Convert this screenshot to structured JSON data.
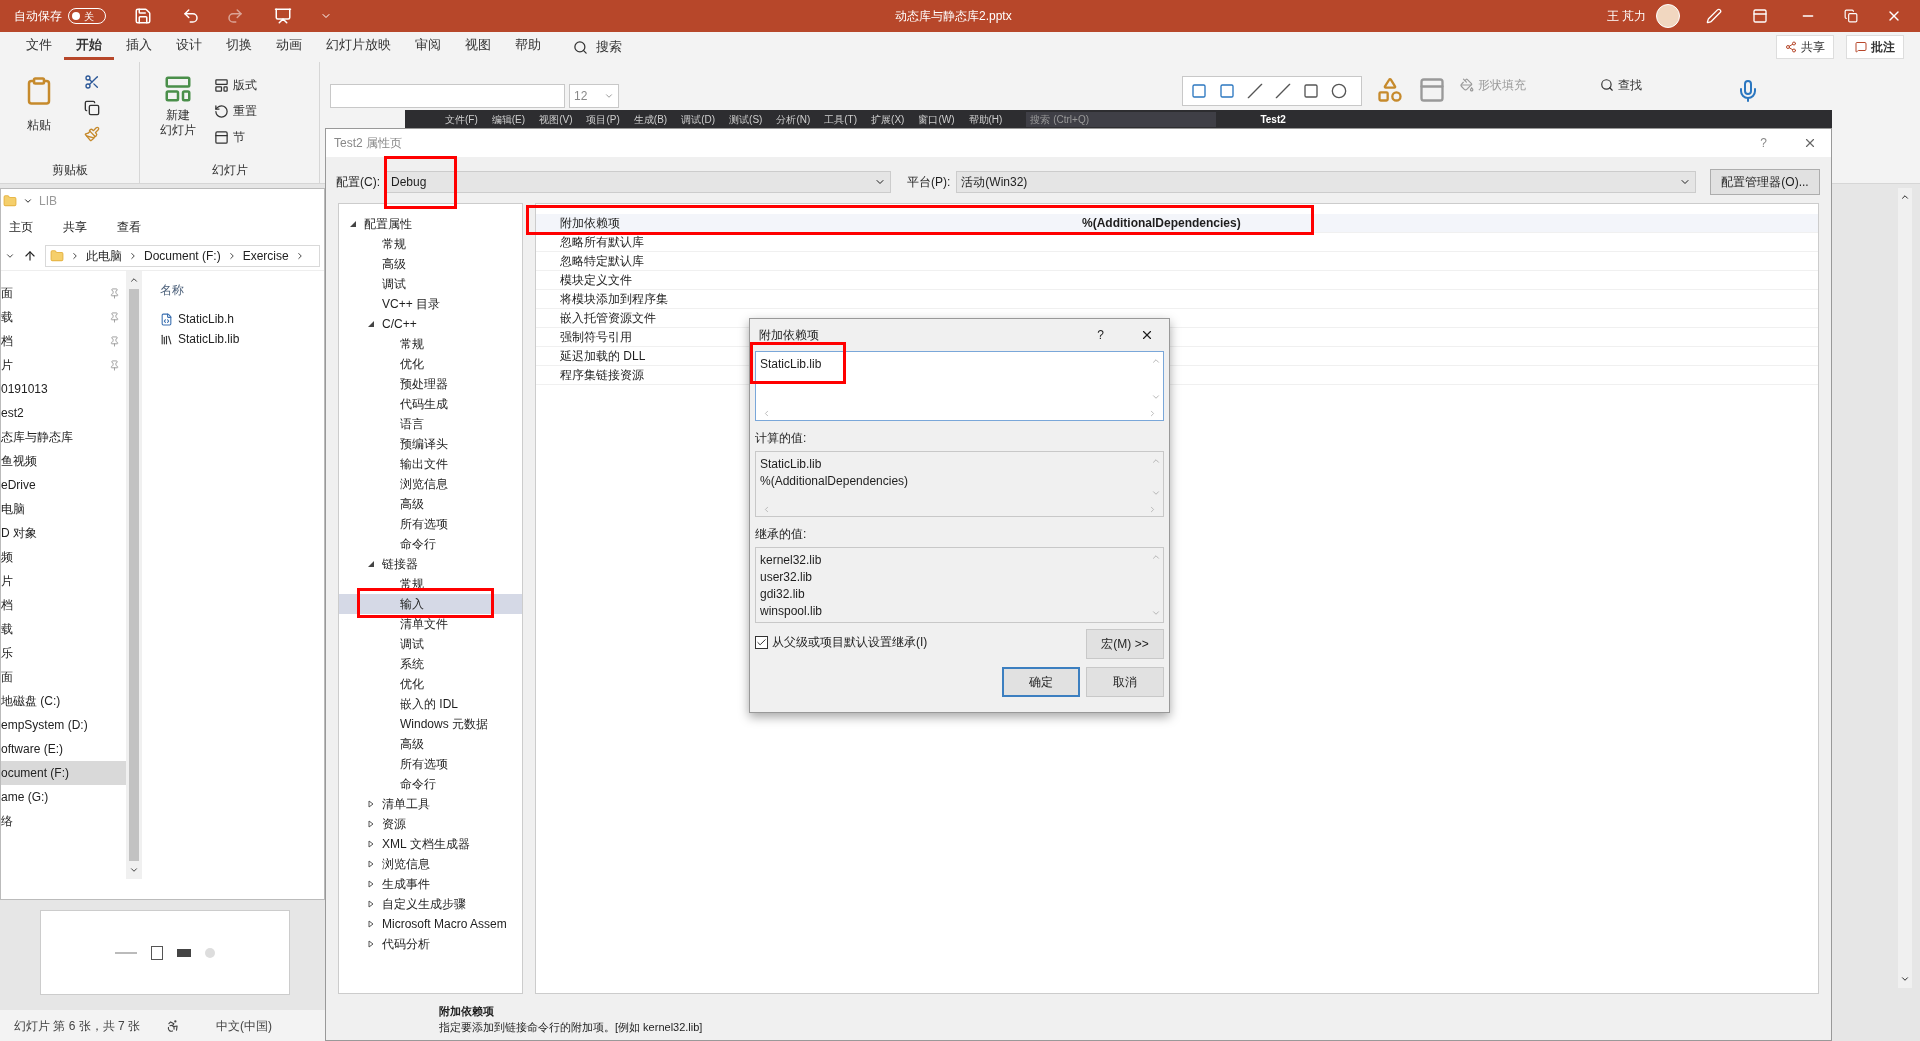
{
  "powerpoint": {
    "autosave_label": "自动保存",
    "autosave_on": false,
    "autosave_state": "关",
    "document_title": "动态库与静态库2.pptx",
    "user_name": "王 芃力",
    "ribbon_tabs": [
      {
        "label": "文件",
        "selected": false
      },
      {
        "label": "开始",
        "selected": true
      },
      {
        "label": "插入",
        "selected": false
      },
      {
        "label": "设计",
        "selected": false
      },
      {
        "label": "切换",
        "selected": false
      },
      {
        "label": "动画",
        "selected": false
      },
      {
        "label": "幻灯片放映",
        "selected": false
      },
      {
        "label": "审阅",
        "selected": false
      },
      {
        "label": "视图",
        "selected": false
      },
      {
        "label": "帮助",
        "selected": false
      }
    ],
    "search_label": "搜索",
    "share_button": "共享",
    "comment_button": "批注",
    "paste_label": "粘贴",
    "clipboard_group": "剪贴板",
    "new_slide_lines": [
      "新建",
      "幻灯片"
    ],
    "layout_button": "版式",
    "reset_button": "重置",
    "section_button": "节",
    "slides_group": "幻灯片",
    "font_size": "12",
    "shape_fill": "形状填充",
    "find_button": "查找",
    "status_slide": "幻灯片 第 6 张，共 7 张",
    "status_language": "中文(中国)"
  },
  "explorer": {
    "title": "LIB",
    "tabs": [
      "主页",
      "共享",
      "查看"
    ],
    "breadcrumb": [
      "此电脑",
      "Document (F:)",
      "Exercise"
    ],
    "nav_items": [
      {
        "label": "面",
        "pinned": true,
        "selected": false
      },
      {
        "label": "载",
        "pinned": true,
        "selected": false
      },
      {
        "label": "档",
        "pinned": true,
        "selected": false
      },
      {
        "label": "片",
        "pinned": true,
        "selected": false
      },
      {
        "label": "0191013",
        "pinned": false,
        "selected": false
      },
      {
        "label": "est2",
        "pinned": false,
        "selected": false
      },
      {
        "label": "态库与静态库",
        "pinned": false,
        "selected": false
      },
      {
        "label": "鱼视频",
        "pinned": false,
        "selected": false
      },
      {
        "label": "eDrive",
        "pinned": false,
        "selected": false
      },
      {
        "label": "电脑",
        "pinned": false,
        "selected": false
      },
      {
        "label": "D 对象",
        "pinned": false,
        "selected": false
      },
      {
        "label": "频",
        "pinned": false,
        "selected": false
      },
      {
        "label": "片",
        "pinned": false,
        "selected": false
      },
      {
        "label": "档",
        "pinned": false,
        "selected": false
      },
      {
        "label": "载",
        "pinned": false,
        "selected": false
      },
      {
        "label": "乐",
        "pinned": false,
        "selected": false
      },
      {
        "label": "面",
        "pinned": false,
        "selected": false
      },
      {
        "label": "地磁盘 (C:)",
        "pinned": false,
        "selected": false
      },
      {
        "label": "empSystem (D:)",
        "pinned": false,
        "selected": false
      },
      {
        "label": "oftware (E:)",
        "pinned": false,
        "selected": false
      },
      {
        "label": "ocument (F:)",
        "pinned": false,
        "selected": true
      },
      {
        "label": "ame (G:)",
        "pinned": false,
        "selected": false
      },
      {
        "label": "络",
        "pinned": false,
        "selected": false
      }
    ],
    "column_header": "名称",
    "files": [
      {
        "name": "StaticLib.h",
        "kind": "header"
      },
      {
        "name": "StaticLib.lib",
        "kind": "library"
      }
    ]
  },
  "visual_studio": {
    "menu": [
      "文件(F)",
      "编辑(E)",
      "视图(V)",
      "项目(P)",
      "生成(B)",
      "调试(D)",
      "测试(S)",
      "分析(N)",
      "工具(T)",
      "扩展(X)",
      "窗口(W)",
      "帮助(H)"
    ],
    "search": "搜索 (Ctrl+Q)",
    "solution": "Test2"
  },
  "property_pages": {
    "title": "Test2 属性页",
    "help_label": "?",
    "config_label": "配置(C):",
    "config_value": "Debug",
    "config_annotated": true,
    "platform_label": "平台(P):",
    "platform_value": "活动(Win32)",
    "config_manager_button": "配置管理器(O)...",
    "tree": [
      {
        "label": "配置属性",
        "expanded": true,
        "selected": false,
        "annotated": false,
        "children": [
          {
            "label": "常规",
            "selected": false,
            "annotated": false
          },
          {
            "label": "高级",
            "selected": false,
            "annotated": false
          },
          {
            "label": "调试",
            "selected": false,
            "annotated": false
          },
          {
            "label": "VC++ 目录",
            "selected": false,
            "annotated": false
          },
          {
            "label": "C/C++",
            "expanded": true,
            "selected": false,
            "annotated": false,
            "children": [
              {
                "label": "常规",
                "selected": false,
                "annotated": false
              },
              {
                "label": "优化",
                "selected": false,
                "annotated": false
              },
              {
                "label": "预处理器",
                "selected": false,
                "annotated": false
              },
              {
                "label": "代码生成",
                "selected": false,
                "annotated": false
              },
              {
                "label": "语言",
                "selected": false,
                "annotated": false
              },
              {
                "label": "预编译头",
                "selected": false,
                "annotated": false
              },
              {
                "label": "输出文件",
                "selected": false,
                "annotated": false
              },
              {
                "label": "浏览信息",
                "selected": false,
                "annotated": false
              },
              {
                "label": "高级",
                "selected": false,
                "annotated": false
              },
              {
                "label": "所有选项",
                "selected": false,
                "annotated": false
              },
              {
                "label": "命令行",
                "selected": false,
                "annotated": false
              }
            ]
          },
          {
            "label": "链接器",
            "expanded": true,
            "selected": false,
            "annotated": false,
            "children": [
              {
                "label": "常规",
                "selected": false,
                "annotated": false
              },
              {
                "label": "输入",
                "selected": true,
                "annotated": true
              },
              {
                "label": "清单文件",
                "selected": false,
                "annotated": false
              },
              {
                "label": "调试",
                "selected": false,
                "annotated": false
              },
              {
                "label": "系统",
                "selected": false,
                "annotated": false
              },
              {
                "label": "优化",
                "selected": false,
                "annotated": false
              },
              {
                "label": "嵌入的 IDL",
                "selected": false,
                "annotated": false
              },
              {
                "label": "Windows 元数据",
                "selected": false,
                "annotated": false
              },
              {
                "label": "高级",
                "selected": false,
                "annotated": false
              },
              {
                "label": "所有选项",
                "selected": false,
                "annotated": false
              },
              {
                "label": "命令行",
                "selected": false,
                "annotated": false
              }
            ]
          },
          {
            "label": "清单工具",
            "expanded": false,
            "selected": false,
            "annotated": false
          },
          {
            "label": "资源",
            "expanded": false,
            "selected": false,
            "annotated": false
          },
          {
            "label": "XML 文档生成器",
            "expanded": false,
            "selected": false,
            "annotated": false
          },
          {
            "label": "浏览信息",
            "expanded": false,
            "selected": false,
            "annotated": false
          },
          {
            "label": "生成事件",
            "expanded": false,
            "selected": false,
            "annotated": false
          },
          {
            "label": "自定义生成步骤",
            "expanded": false,
            "selected": false,
            "annotated": false
          },
          {
            "label": "Microsoft Macro Assem",
            "expanded": false,
            "selected": false,
            "annotated": false
          },
          {
            "label": "代码分析",
            "expanded": false,
            "selected": false,
            "annotated": false
          }
        ]
      }
    ],
    "grid_rows": [
      {
        "name": "附加依赖项",
        "value": "%(AdditionalDependencies)",
        "selected": true,
        "annotated": true
      },
      {
        "name": "忽略所有默认库",
        "selected": false,
        "annotated": false
      },
      {
        "name": "忽略特定默认库",
        "selected": false,
        "annotated": false
      },
      {
        "name": "模块定义文件",
        "selected": false,
        "annotated": false
      },
      {
        "name": "将模块添加到程序集",
        "selected": false,
        "annotated": false
      },
      {
        "name": "嵌入托管资源文件",
        "selected": false,
        "annotated": false
      },
      {
        "name": "强制符号引用",
        "selected": false,
        "annotated": false
      },
      {
        "name": "延迟加载的 DLL",
        "selected": false,
        "annotated": false
      },
      {
        "name": "程序集链接资源",
        "selected": false,
        "annotated": false
      }
    ],
    "description_title": "附加依赖项",
    "description_text": "指定要添加到链接命令行的附加项。[例如 kernel32.lib]"
  },
  "dialog": {
    "title": "附加依赖项",
    "help_label": "?",
    "input_lines": [
      "StaticLib.lib"
    ],
    "input_annotated": true,
    "evaluated_label": "计算的值:",
    "evaluated_lines": [
      "StaticLib.lib",
      "%(AdditionalDependencies)"
    ],
    "inherited_label": "继承的值:",
    "inherited_lines": [
      "kernel32.lib",
      "user32.lib",
      "gdi32.lib",
      "winspool.lib"
    ],
    "inherit_checkbox": {
      "label": "从父级或项目默认设置继承(I)",
      "checked": true
    },
    "macros_button": "宏(M) >>",
    "ok_button": "确定",
    "cancel_button": "取消"
  }
}
